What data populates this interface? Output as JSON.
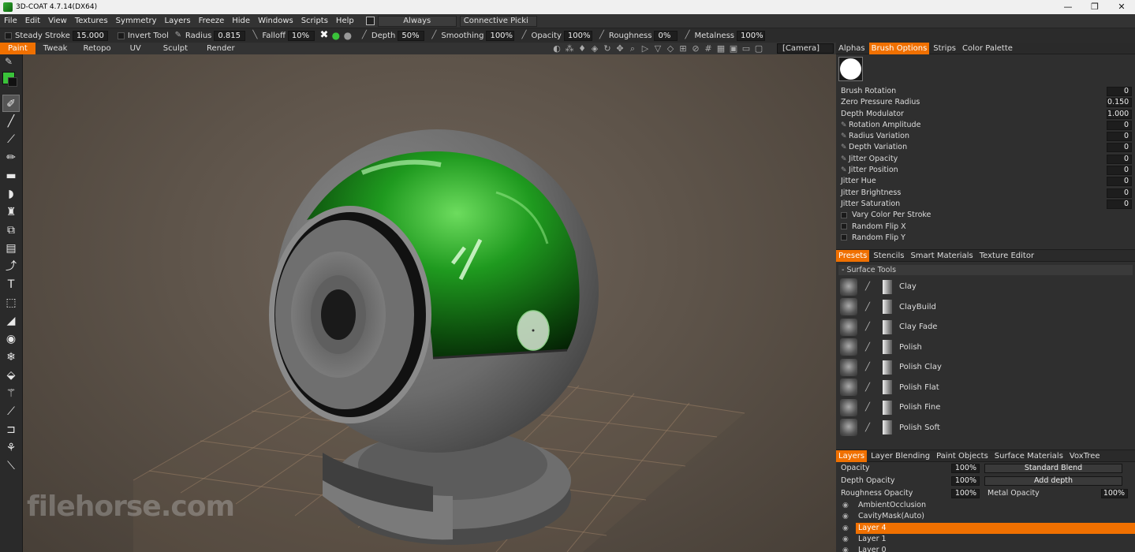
{
  "window": {
    "title": "3D-COAT 4.7.14(DX64)",
    "controls": [
      "—",
      "❐",
      "✕"
    ]
  },
  "menu": {
    "items": [
      "File",
      "Edit",
      "View",
      "Textures",
      "Symmetry",
      "Layers",
      "Freeze",
      "Hide",
      "Windows",
      "Scripts",
      "Help"
    ],
    "always_combo": "Always",
    "connective_combo": "Connective Picki"
  },
  "toolbar": {
    "steady_label": "Steady Stroke",
    "steady_value": "15.000",
    "invert_label": "Invert Tool",
    "radius_label": "Radius",
    "radius_value": "0.815",
    "falloff_label": "Falloff",
    "falloff_value": "10%",
    "depth_label": "Depth",
    "depth_value": "50%",
    "smoothing_label": "Smoothing",
    "smoothing_value": "100%",
    "opacity_label": "Opacity",
    "opacity_value": "100%",
    "roughness_label": "Roughness",
    "roughness_value": "0%",
    "metalness_label": "Metalness",
    "metalness_value": "100%"
  },
  "rooms": [
    "Paint",
    "Tweak",
    "Retopo",
    "UV",
    "Sculpt",
    "Render"
  ],
  "camera_label": "[Camera]",
  "colors": {
    "primary": "#3ac23a",
    "secondary": "#111111",
    "accent": "#f07000"
  },
  "brush_panel": {
    "tabs": [
      "Alphas",
      "Brush Options",
      "Strips",
      "Color Palette"
    ],
    "rows": [
      {
        "label": "Brush Rotation",
        "value": "0",
        "pen": false
      },
      {
        "label": "Zero Pressure Radius",
        "value": "0.150",
        "pen": false
      },
      {
        "label": "Depth Modulator",
        "value": "1.000",
        "pen": false
      },
      {
        "label": "Rotation Amplitude",
        "value": "0",
        "pen": true
      },
      {
        "label": "Radius Variation",
        "value": "0",
        "pen": true
      },
      {
        "label": "Depth Variation",
        "value": "0",
        "pen": true
      },
      {
        "label": "Jitter Opacity",
        "value": "0",
        "pen": true
      },
      {
        "label": "Jitter Position",
        "value": "0",
        "pen": true
      },
      {
        "label": "Jitter Hue",
        "value": "0",
        "pen": false
      },
      {
        "label": "Jitter Brightness",
        "value": "0",
        "pen": false
      },
      {
        "label": "Jitter Saturation",
        "value": "0",
        "pen": false
      }
    ],
    "checkboxes": [
      "Vary Color Per Stroke",
      "Random Flip X",
      "Random Flip Y"
    ]
  },
  "presets_panel": {
    "tabs": [
      "Presets",
      "Stencils",
      "Smart Materials",
      "Texture Editor"
    ],
    "group": "Surface Tools",
    "items": [
      "Clay",
      "ClayBuild",
      "Clay Fade",
      "Polish",
      "Polish Clay",
      "Polish Flat",
      "Polish Fine",
      "Polish Soft"
    ]
  },
  "layers_panel": {
    "tabs": [
      "Layers",
      "Layer Blending",
      "Paint Objects",
      "Surface Materials",
      "VoxTree"
    ],
    "opacity_label": "Opacity",
    "opacity_value": "100%",
    "blend_mode": "Standard Blend",
    "depth_opacity_label": "Depth Opacity",
    "depth_opacity_value": "100%",
    "depth_mode": "Add depth",
    "roughness_opacity_label": "Roughness Opacity",
    "roughness_opacity_value": "100%",
    "metal_opacity_label": "Metal Opacity",
    "metal_opacity_value": "100%",
    "layers": [
      "AmbientOcclusion",
      "CavityMask(Auto)",
      "Layer 4",
      "Layer 1",
      "Layer 0"
    ],
    "selected": "Layer 4"
  },
  "watermark": "filehorse.com"
}
